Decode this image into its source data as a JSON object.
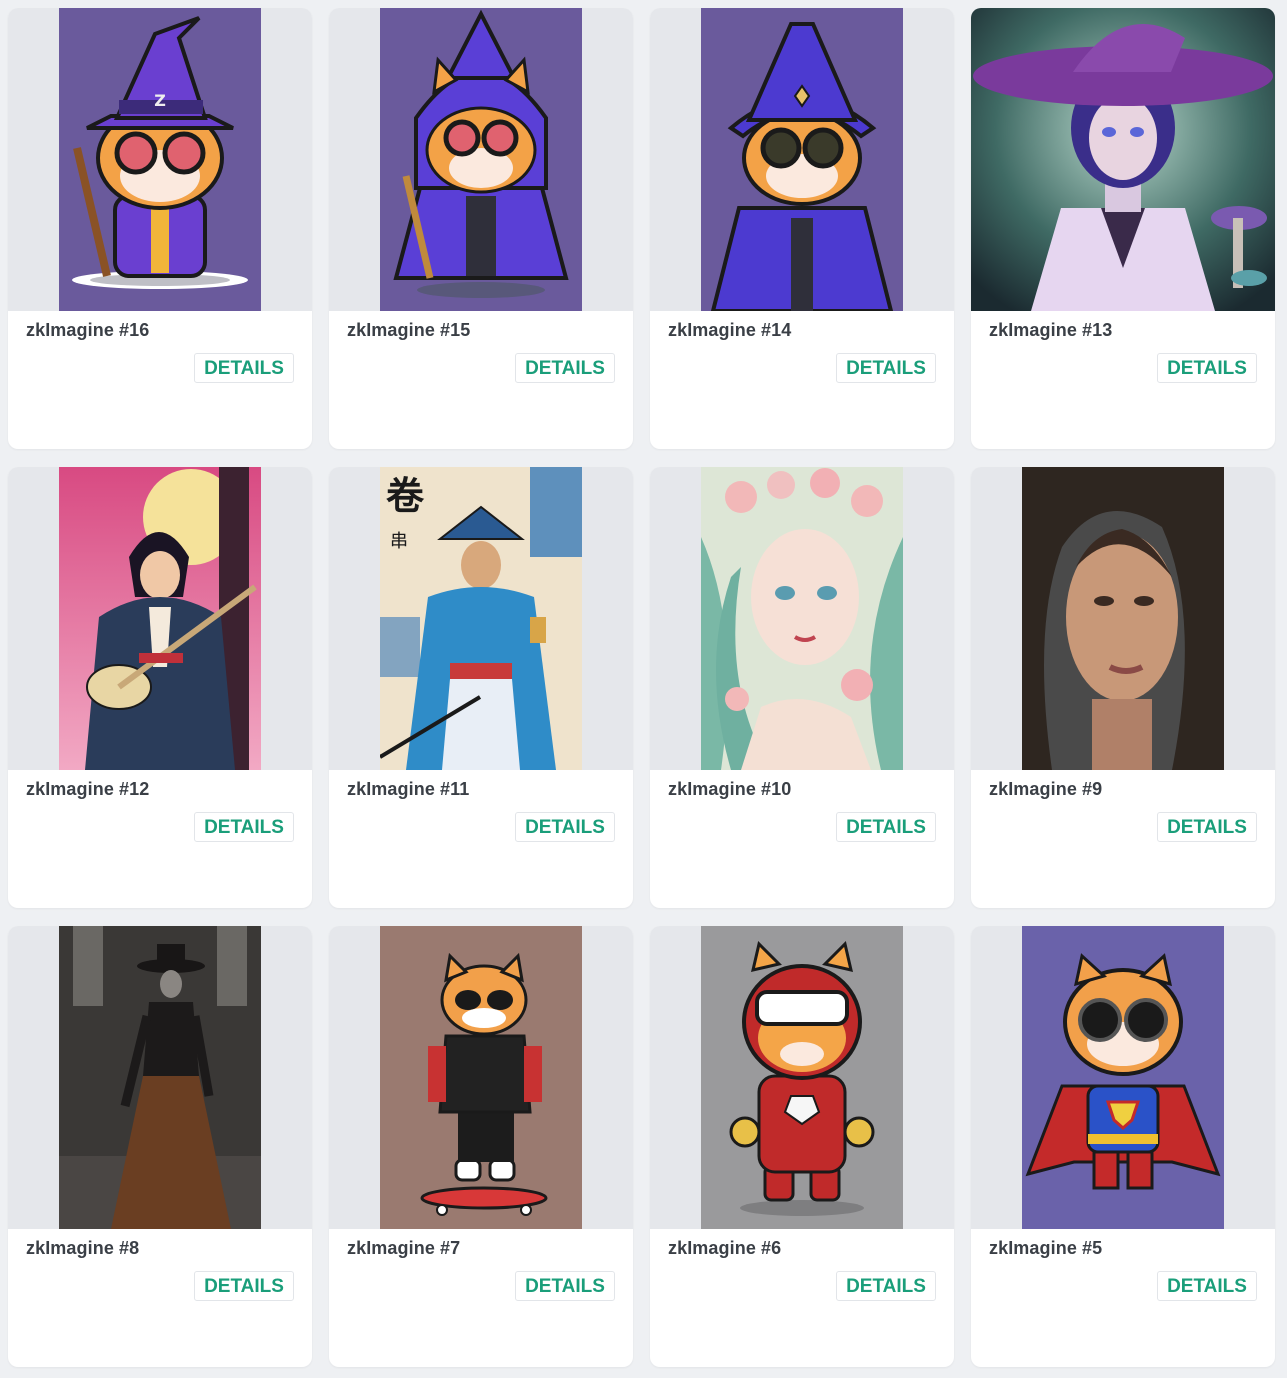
{
  "gallery": {
    "button_label": "DETAILS",
    "cards": [
      {
        "title": "zkImagine #16",
        "image": "wizard-cat-pink-goggles"
      },
      {
        "title": "zkImagine #15",
        "image": "wizard-cat-hooded-robe"
      },
      {
        "title": "zkImagine #14",
        "image": "wizard-cat-dark-goggles"
      },
      {
        "title": "zkImagine #13",
        "image": "witch-girl-mushrooms"
      },
      {
        "title": "zkImagine #12",
        "image": "samurai-guitarist"
      },
      {
        "title": "zkImagine #11",
        "image": "samurai-blue-kimono"
      },
      {
        "title": "zkImagine #10",
        "image": "flower-crown-maiden"
      },
      {
        "title": "zkImagine #9",
        "image": "hooded-woman-portrait"
      },
      {
        "title": "zkImagine #8",
        "image": "gothic-lady-cathedral"
      },
      {
        "title": "zkImagine #7",
        "image": "skater-cat-hoodie"
      },
      {
        "title": "zkImagine #6",
        "image": "armored-hero-cat"
      },
      {
        "title": "zkImagine #5",
        "image": "superhero-cat-cape"
      }
    ]
  }
}
